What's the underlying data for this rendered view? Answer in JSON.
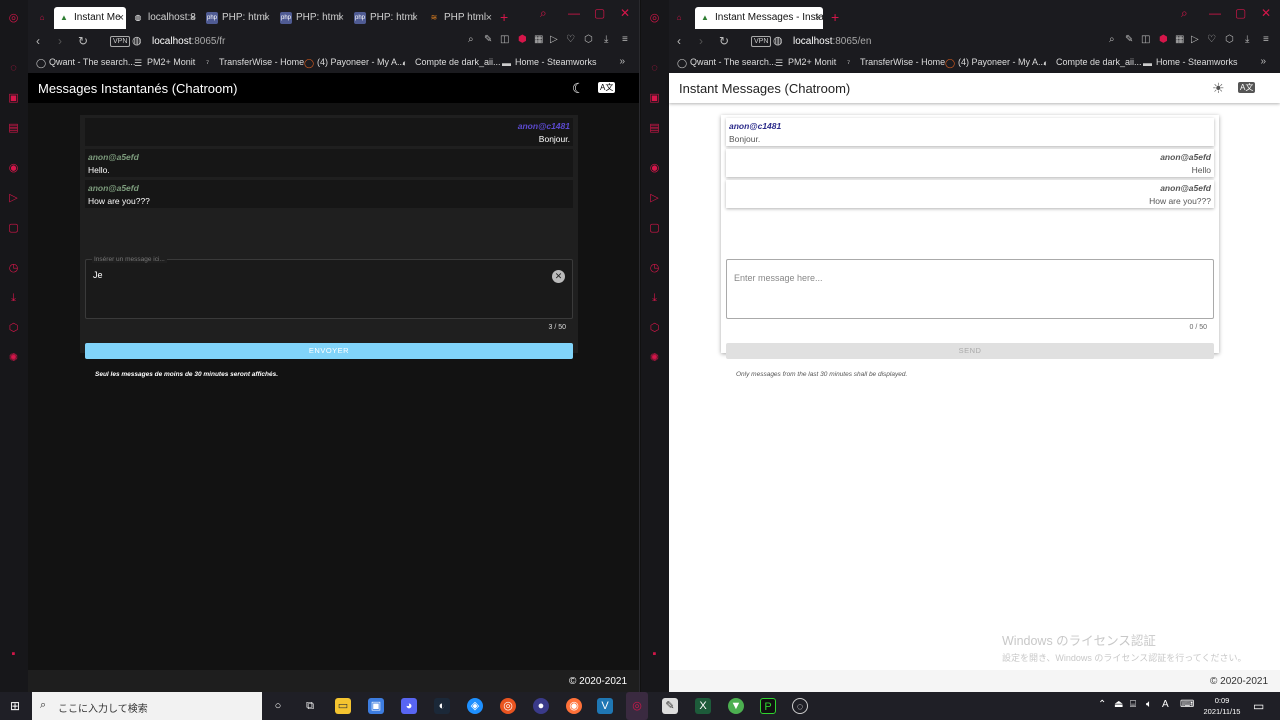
{
  "left": {
    "tabs": [
      {
        "label": "Instant Me",
        "active": true
      },
      {
        "label": "localhost:8",
        "active": false
      },
      {
        "label": "PHP: html",
        "active": false
      },
      {
        "label": "PHP: html",
        "active": false
      },
      {
        "label": "PHP: html",
        "active": false
      },
      {
        "label": "PHP html",
        "active": false
      }
    ],
    "url_host": "localhost",
    "url_path": ":8065/fr",
    "app_title": "Messages Instantanés (Chatroom)",
    "messages": [
      {
        "user": "anon@c1481",
        "text": "Bonjour.",
        "align": "right"
      },
      {
        "user": "anon@a5efd",
        "text": "Hello.",
        "align": "left"
      },
      {
        "user": "anon@a5efd",
        "text": "How are you???",
        "align": "left"
      }
    ],
    "input_placeholder": "Insérer un message ici...",
    "input_value": "Je",
    "counter": "3 / 50",
    "send_label": "ENVOYER",
    "note": "Seul les messages de moins de 30 minutes seront affichés.",
    "footer": "© 2020-2021"
  },
  "right": {
    "tabs": [
      {
        "label": "Instant Messages - Instant",
        "active": true
      }
    ],
    "url_host": "localhost",
    "url_path": ":8065/en",
    "app_title": "Instant Messages (Chatroom)",
    "messages": [
      {
        "user": "anon@c1481",
        "text": "Bonjour.",
        "align": "left"
      },
      {
        "user": "anon@a5efd",
        "text": "Hello",
        "align": "right"
      },
      {
        "user": "anon@a5efd",
        "text": "How are you???",
        "align": "right"
      }
    ],
    "input_placeholder": "Enter message here...",
    "counter": "0 / 50",
    "send_label": "SEND",
    "note": "Only messages from the last 30 minutes shall be displayed.",
    "footer": "© 2020-2021"
  },
  "bookmarks": [
    "Qwant - The search...",
    "PM2+ Monit",
    "TransferWise - Home",
    "(4) Payoneer - My A...",
    "Compte de dark_aii...",
    "Home - Steamworks"
  ],
  "watermark": {
    "line1": "Windows のライセンス認証",
    "line2": "設定を開き、Windows のライセンス認証を行ってください。"
  },
  "taskbar": {
    "search_placeholder": "ここに入力して検索",
    "time": "0:09",
    "date": "2021/11/15"
  },
  "colors": {
    "accent": "#d5164a",
    "dark_card": "#1f1f1f",
    "dark_msg": "#161616",
    "send_dark": "#81d4fa",
    "user_purple": "#5c4ad0",
    "user_green": "#7d9c7d",
    "user_purple_light": "#2a2a8a"
  }
}
